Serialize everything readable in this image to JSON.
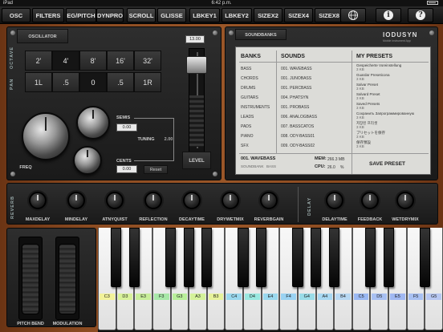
{
  "status": {
    "device": "iPad",
    "time": "6:42 p.m."
  },
  "topbar": {
    "buttons": [
      "OSC",
      "FILTERS",
      "EG/PITCH",
      "DYNPRO",
      "SCROLL",
      "GLISSE",
      "LBKEY1",
      "LBKEY2",
      "SIZEX2",
      "SIZEX4",
      "SIZEX8"
    ],
    "info_symbol": "i",
    "help_symbol": "?"
  },
  "oscillator": {
    "title": "OSCILLATOR",
    "octave_label": "OCTAVE",
    "octaves": [
      "2'",
      "4'",
      "8'",
      "16'",
      "32'"
    ],
    "pan_label": "PAN",
    "pans": [
      "1L",
      ".5",
      "0",
      ".5",
      "1R"
    ],
    "freq_label": "FREQ",
    "semis_label": "SEMIS",
    "semis_value": "0.00",
    "tuning_label": "TUNING",
    "tuning_value": "2.00",
    "cents_label": "CENTS",
    "cents_value": "0.00",
    "reset_label": "Reset",
    "level_value": "13.00",
    "level_label": "LEVEL"
  },
  "soundbanks": {
    "title": "SOUNDBANKS",
    "logo": "IODUSYN",
    "logo_sub": "Mobile Instrument App",
    "headers": {
      "banks": "BANKS",
      "sounds": "SOUNDS",
      "presets": "MY PRESETS"
    },
    "banks": [
      "BASS",
      "CHORDS",
      "DRUMS",
      "GUITARS",
      "INSTRUMENTS",
      "LEADS",
      "PADS",
      "PIANO",
      "SFX"
    ],
    "sounds": [
      "001. WAVEBASS",
      "001. JUNOBASS",
      "001. PERCBASS",
      "004. PHATSYN",
      "001. PROBASS",
      "006. ANALOGBASS",
      "007. BASSCATOS",
      "008. ODY-BASS01",
      "009. ODY-BASS02"
    ],
    "presets": [
      {
        "name": "Gespeicherte Voreinstellung",
        "size": "3 KB"
      },
      {
        "name": "Guardar Preseticona",
        "size": "3 KB"
      },
      {
        "name": "Salvar Preset",
        "size": "3 KB"
      },
      {
        "name": "Salvard Preset",
        "size": "3 KB"
      },
      {
        "name": "Saved Presets",
        "size": "3 KB"
      },
      {
        "name": "Сохранить Запрограммированную",
        "size": "3 KB"
      },
      {
        "name": "저장된 프리셋",
        "size": "3 KB"
      },
      {
        "name": "プリセットを保存",
        "size": "3 KB"
      },
      {
        "name": "保存預設",
        "size": "3 KB"
      }
    ],
    "current_sound": "001. WAVEBASS",
    "current_bank_label": "SOUNDBANK",
    "current_bank": "BASS",
    "mem_label": "MEM:",
    "mem_value": "266.3 MB",
    "cpu_label": "CPU:",
    "cpu_value": "26.0",
    "cpu_unit": "%",
    "save_label": "SAVE PRESET"
  },
  "effects": {
    "reverb_label": "REVERB",
    "delay_label": "DELAY",
    "knobs": [
      "MAXDELAY",
      "MINDELAY",
      "ATNYQUIST",
      "REFLECTION",
      "DECAYTIME",
      "DRYWETMIX",
      "REVERBGAIN",
      "DELAYTIME",
      "FEEDBACK",
      "WETDRYMIX"
    ]
  },
  "wheels": {
    "pitch": "PITCH BEND",
    "mod": "MODULATION"
  },
  "keyboard": {
    "white_labels": [
      "C3",
      "D3",
      "E3",
      "F3",
      "G3",
      "A3",
      "B3",
      "C4",
      "D4",
      "E4",
      "F4",
      "G4",
      "A4",
      "B4",
      "C5",
      "D5",
      "E5",
      "F5",
      "G5"
    ],
    "label_colors": [
      "#f2f29a",
      "#d8f29a",
      "#c8ee9a",
      "#a8e8a8",
      "#b8ee9a",
      "#d4f29a",
      "#e6f29a",
      "#9ad8ee",
      "#9ae8e0",
      "#9ad8ee",
      "#9ad2f2",
      "#9adce8",
      "#a8d8f2",
      "#b8d8f2",
      "#9ab8f2",
      "#a8c0f2",
      "#a0b8f2",
      "#a8c0f2",
      "#b8c8f2"
    ]
  }
}
